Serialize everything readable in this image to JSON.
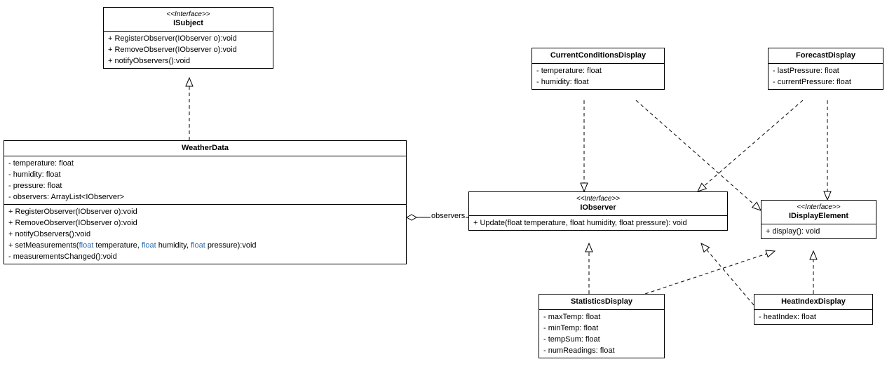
{
  "isubject": {
    "stereo": "<<Interface>>",
    "name": "ISubject",
    "m1": "+ RegisterObserver(IObserver o):void",
    "m2": "+ RemoveObserver(IObserver o):void",
    "m3": "+ notifyObservers():void"
  },
  "weather": {
    "name": "WeatherData",
    "a1": "- temperature: float",
    "a2": "- humidity: float",
    "a3": "- pressure: float",
    "a4": "- observers: ArrayList<IObserver>",
    "m1": "+ RegisterObserver(IObserver o):void",
    "m2": "+ RemoveObserver(IObserver o):void",
    "m3": "+ notifyObservers():void",
    "m4_pre": "+ setMeasurements(",
    "m4_kw1": "float",
    "m4_t1": " temperature, ",
    "m4_kw2": "float",
    "m4_t2": " humidity, ",
    "m4_kw3": "float",
    "m4_t3": " pressure):void",
    "m5": "- measurementsChanged():void"
  },
  "iobserver": {
    "stereo": "<<Interface>>",
    "name": "IObserver",
    "m1": "+ Update(float temperature, float humidity, float pressure): void"
  },
  "idisplay": {
    "stereo": "<<Interface>>",
    "name": "IDisplayElement",
    "m1": "+ display(): void"
  },
  "current": {
    "name": "CurrentConditionsDisplay",
    "a1": "- temperature: float",
    "a2": "- humidity: float"
  },
  "forecast": {
    "name": "ForecastDisplay",
    "a1": "- lastPressure: float",
    "a2": "- currentPressure: float"
  },
  "stats": {
    "name": "StatisticsDisplay",
    "a1": "- maxTemp: float",
    "a2": "- minTemp: float",
    "a3": "- tempSum: float",
    "a4": "- numReadings: float"
  },
  "heat": {
    "name": "HeatIndexDisplay",
    "a1": "- heatIndex: float"
  },
  "labels": {
    "observers": "observers"
  },
  "chart_data": {
    "type": "uml-class-diagram",
    "classes": [
      {
        "id": "ISubject",
        "stereotype": "Interface",
        "attributes": [],
        "operations": [
          "+ RegisterObserver(IObserver o):void",
          "+ RemoveObserver(IObserver o):void",
          "+ notifyObservers():void"
        ]
      },
      {
        "id": "WeatherData",
        "attributes": [
          "- temperature: float",
          "- humidity: float",
          "- pressure: float",
          "- observers: ArrayList<IObserver>"
        ],
        "operations": [
          "+ RegisterObserver(IObserver o):void",
          "+ RemoveObserver(IObserver o):void",
          "+ notifyObservers():void",
          "+ setMeasurements(float temperature, float humidity, float pressure):void",
          "- measurementsChanged():void"
        ]
      },
      {
        "id": "IObserver",
        "stereotype": "Interface",
        "attributes": [],
        "operations": [
          "+ Update(float temperature, float humidity, float pressure): void"
        ]
      },
      {
        "id": "IDisplayElement",
        "stereotype": "Interface",
        "attributes": [],
        "operations": [
          "+ display(): void"
        ]
      },
      {
        "id": "CurrentConditionsDisplay",
        "attributes": [
          "- temperature: float",
          "- humidity: float"
        ],
        "operations": []
      },
      {
        "id": "ForecastDisplay",
        "attributes": [
          "- lastPressure: float",
          "- currentPressure: float"
        ],
        "operations": []
      },
      {
        "id": "StatisticsDisplay",
        "attributes": [
          "- maxTemp: float",
          "- minTemp: float",
          "- tempSum: float",
          "- numReadings: float"
        ],
        "operations": []
      },
      {
        "id": "HeatIndexDisplay",
        "attributes": [
          "- heatIndex: float"
        ],
        "operations": []
      }
    ],
    "relationships": [
      {
        "from": "WeatherData",
        "to": "ISubject",
        "type": "realization"
      },
      {
        "from": "WeatherData",
        "to": "IObserver",
        "type": "aggregation",
        "label": "observers"
      },
      {
        "from": "CurrentConditionsDisplay",
        "to": "IObserver",
        "type": "realization"
      },
      {
        "from": "CurrentConditionsDisplay",
        "to": "IDisplayElement",
        "type": "realization"
      },
      {
        "from": "ForecastDisplay",
        "to": "IObserver",
        "type": "realization"
      },
      {
        "from": "ForecastDisplay",
        "to": "IDisplayElement",
        "type": "realization"
      },
      {
        "from": "StatisticsDisplay",
        "to": "IObserver",
        "type": "realization"
      },
      {
        "from": "StatisticsDisplay",
        "to": "IDisplayElement",
        "type": "realization"
      },
      {
        "from": "HeatIndexDisplay",
        "to": "IObserver",
        "type": "realization"
      },
      {
        "from": "HeatIndexDisplay",
        "to": "IDisplayElement",
        "type": "realization"
      }
    ]
  }
}
